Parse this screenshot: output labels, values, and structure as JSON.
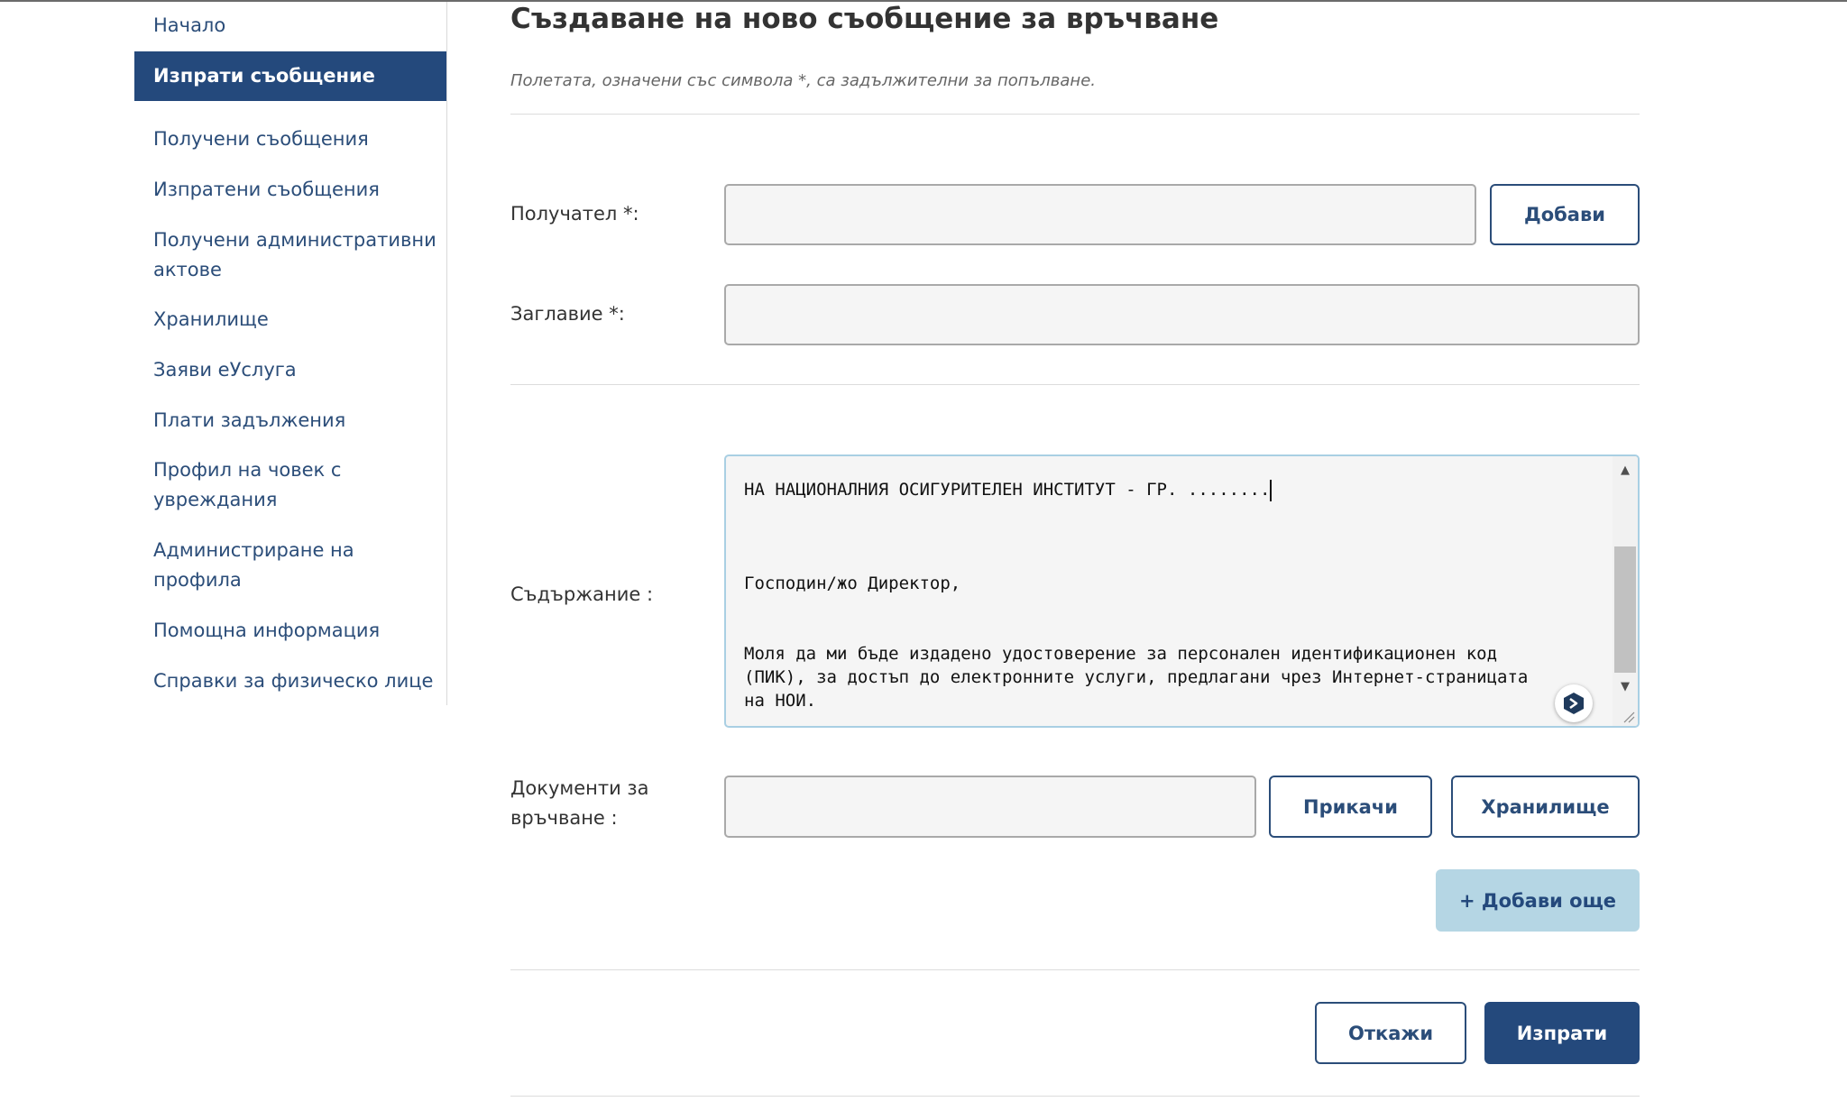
{
  "sidebar": {
    "items": [
      {
        "label": "Начало"
      },
      {
        "label": "Изпрати съобщение",
        "active": true
      },
      {
        "label": "Получени съобщения"
      },
      {
        "label": "Изпратени съобщения"
      },
      {
        "label": "Получени административни актове"
      },
      {
        "label": "Хранилище"
      },
      {
        "label": "Заяви еУслуга"
      },
      {
        "label": "Плати задължения"
      },
      {
        "label": "Профил на човек с увреждания"
      },
      {
        "label": "Администриране на профила"
      },
      {
        "label": "Помощна информация"
      },
      {
        "label": "Справки за физическо лице"
      }
    ]
  },
  "main": {
    "title": "Създаване на ново съобщение за връчване",
    "hint": "Полетата, означени със символа *, са задължителни за попълване.",
    "recipient": {
      "label": "Получател *:",
      "value": "",
      "add_button": "Добави"
    },
    "subject": {
      "label": "Заглавие *:",
      "value": ""
    },
    "content": {
      "label": "Съдържание :",
      "line1": "НА НАЦИОНАЛНИЯ ОСИГУРИТЕЛЕН ИНСТИТУТ - ГР. ........",
      "line2": "Господин/жо Директор,",
      "line3": "Моля да ми бъде издадено удостоверение за персонален идентификационен код",
      "line4": "(ПИК), за достъп до електронните услуги, предлагани чрез Интернет-страницата",
      "line5": "на НОИ."
    },
    "documents": {
      "label": "Документи за връчване :",
      "value": "",
      "attach_button": "Прикачи",
      "storage_button": "Хранилище",
      "add_more_button": "+ Добави още"
    },
    "actions": {
      "cancel": "Откажи",
      "send": "Изпрати"
    }
  },
  "colors": {
    "primary": "#24497c",
    "link": "#2b4d79",
    "light_button": "#b5d6e4",
    "input_bg": "#f5f5f5",
    "divider": "#dcdcdc"
  },
  "icons": {
    "scroll_up": "triangle-up-icon",
    "scroll_down": "triangle-down-icon",
    "resize": "resize-handle-icon",
    "extension": "extension-badge-icon"
  }
}
